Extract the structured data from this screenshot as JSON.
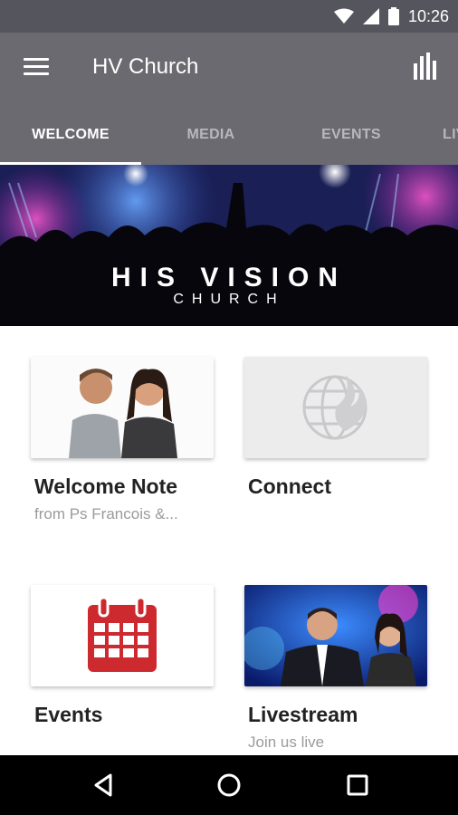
{
  "status_bar": {
    "time": "10:26",
    "icons": [
      "wifi-icon",
      "signal-icon",
      "battery-icon"
    ]
  },
  "app_bar": {
    "title": "HV Church",
    "menu_icon": "hamburger-menu-icon",
    "action_icon": "bar-chart-icon"
  },
  "tabs": [
    {
      "label": "WELCOME",
      "active": true
    },
    {
      "label": "MEDIA",
      "active": false
    },
    {
      "label": "EVENTS",
      "active": false
    },
    {
      "label": "LIVE",
      "active": false
    }
  ],
  "hero": {
    "title": "HIS VISION",
    "subtitle": "CHURCH"
  },
  "tiles": [
    {
      "title": "Welcome Note",
      "subtitle": "from Ps Francois &...",
      "image": "couple-photo"
    },
    {
      "title": "Connect",
      "subtitle": "",
      "image": "globe-flame-logo"
    },
    {
      "title": "Events",
      "subtitle": "",
      "image": "calendar-icon"
    },
    {
      "title": "Livestream",
      "subtitle": "Join us live",
      "image": "stage-photo"
    }
  ],
  "colors": {
    "appbar": "#6b6a71",
    "statusbar": "#55555d",
    "calendar_red": "#cc2a2f"
  },
  "nav_bar": {
    "icons": [
      "back-icon",
      "home-icon",
      "recents-icon"
    ]
  }
}
